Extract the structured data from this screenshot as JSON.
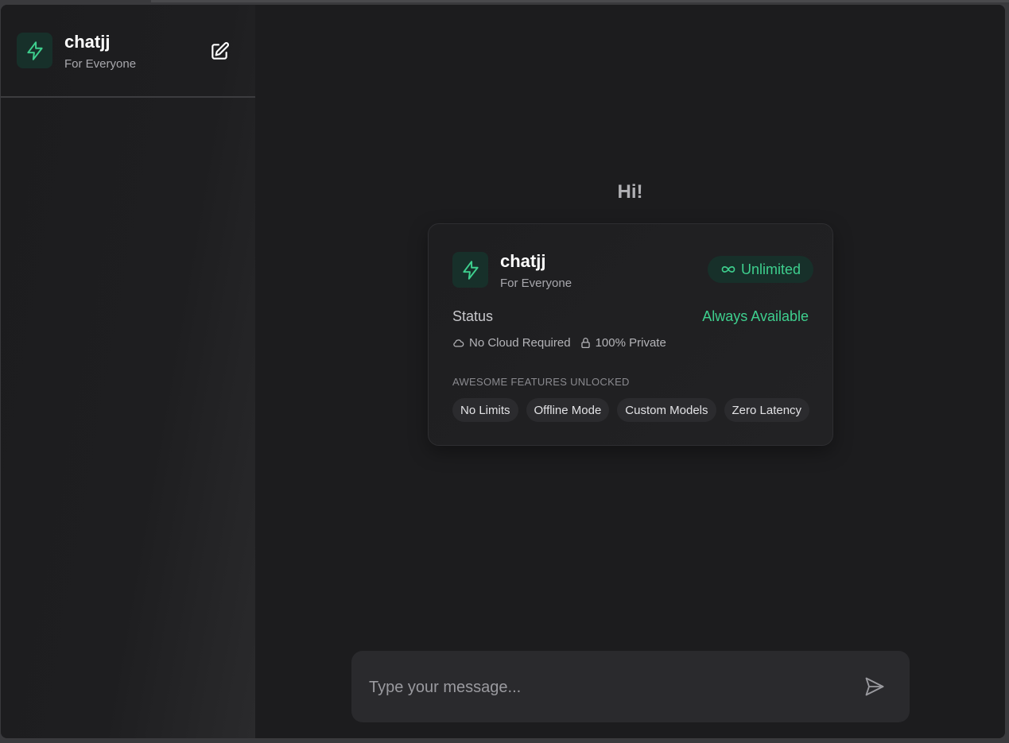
{
  "colors": {
    "accent": "#3ecf8e",
    "background": "#1c1c1e",
    "card": "#222224"
  },
  "sidebar": {
    "brand": {
      "icon": "lightning-bolt-icon",
      "title": "chatjj",
      "subtitle": "For Everyone"
    },
    "new_chat_icon": "edit-icon"
  },
  "main": {
    "greeting": "Hi!",
    "card": {
      "icon": "lightning-bolt-icon",
      "title": "chatjj",
      "subtitle": "For Everyone",
      "badge": "Unlimited",
      "badge_icon": "infinity-icon",
      "status_label": "Status",
      "status_value": "Always Available",
      "meta": [
        {
          "icon": "cloud-icon",
          "text": "No Cloud Required"
        },
        {
          "icon": "lock-icon",
          "text": "100% Private"
        }
      ],
      "features_label": "AWESOME FEATURES UNLOCKED",
      "features": [
        "No Limits",
        "Offline Mode",
        "Custom Models",
        "Zero Latency"
      ]
    },
    "composer": {
      "placeholder": "Type your message...",
      "send_icon": "send-icon"
    }
  }
}
